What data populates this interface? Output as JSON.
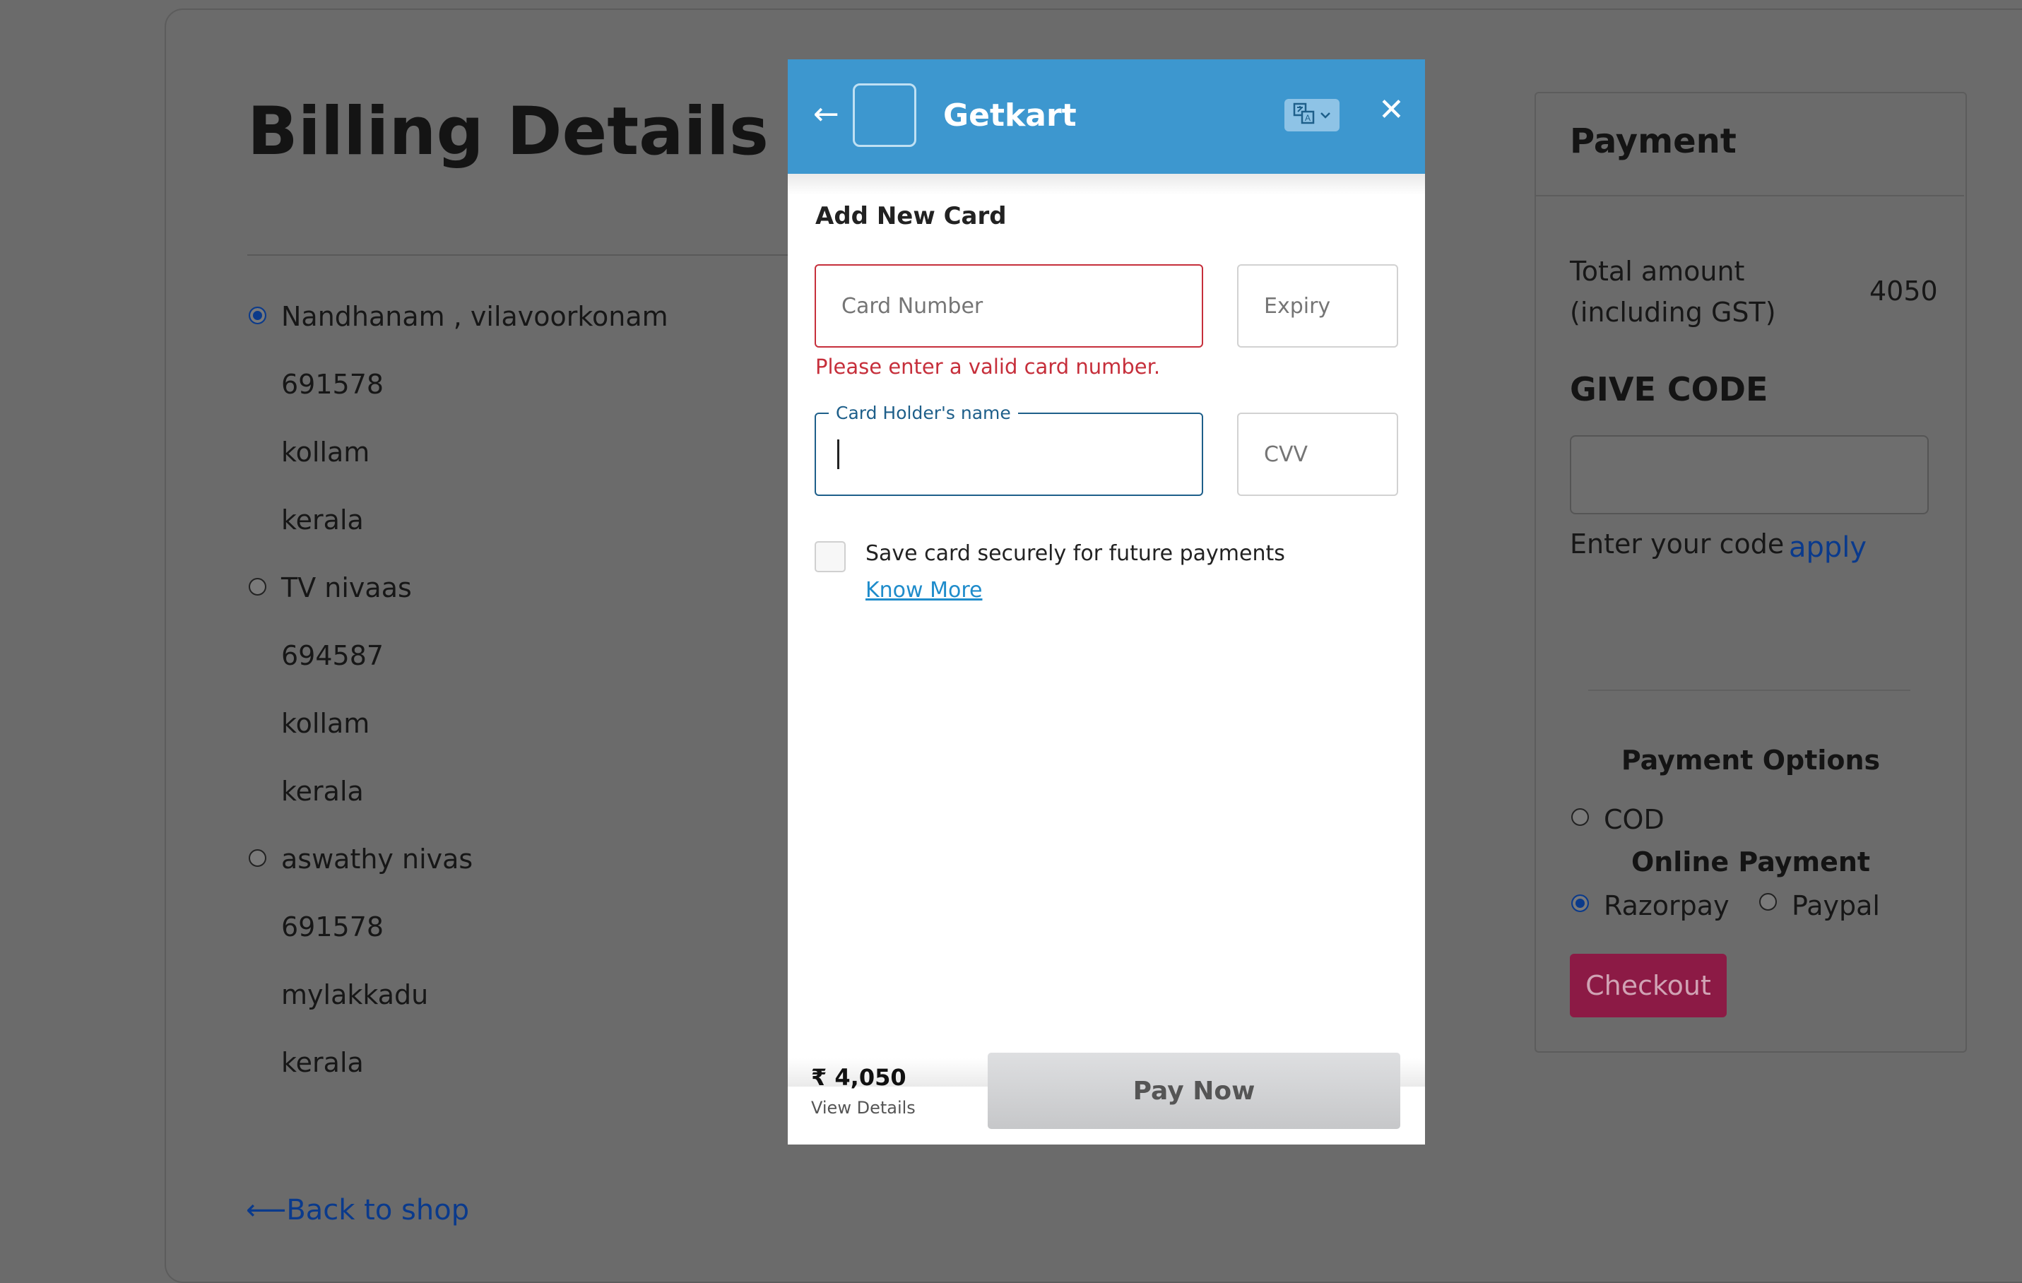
{
  "billing": {
    "title": "Billing Details",
    "addresses": [
      {
        "name": "Nandhanam , vilavoorkonam",
        "pin": "691578",
        "city": "kollam",
        "state": "kerala",
        "selected": true
      },
      {
        "name": "TV nivaas",
        "pin": "694587",
        "city": "kollam",
        "state": "kerala",
        "selected": false
      },
      {
        "name": "aswathy nivas",
        "pin": "691578",
        "city": "mylakkadu",
        "state": "kerala",
        "selected": false
      }
    ],
    "back_link": "⟵Back to shop"
  },
  "payment_panel": {
    "title": "Payment",
    "total_label_line1": "Total amount",
    "total_label_line2": "(including GST)",
    "total_value": "4050",
    "give_code_heading": "GIVE CODE",
    "code_input_value": "",
    "enter_code_label": "Enter your code",
    "apply_label": "apply",
    "options_heading": "Payment Options",
    "cod_label": "COD",
    "online_heading": "Online Payment",
    "razorpay_label": "Razorpay",
    "paypal_label": "Paypal",
    "selected_method": "Razorpay",
    "checkout_label": "Checkout"
  },
  "modal": {
    "brand_name": "Getkart",
    "header_color": "#3d97cf",
    "section_title": "Add New Card",
    "card_number_placeholder": "Card Number",
    "card_number_error": "Please enter a valid card number.",
    "expiry_placeholder": "Expiry",
    "card_holder_label": "Card Holder's name",
    "cvv_placeholder": "CVV",
    "save_card_label": "Save card securely for future payments",
    "know_more_label": "Know More",
    "amount": "₹ 4,050",
    "view_details_label": "View Details",
    "pay_now_label": "Pay Now"
  },
  "icons": {
    "back": "arrow-left-icon",
    "language": "translate-icon",
    "close": "close-icon"
  }
}
